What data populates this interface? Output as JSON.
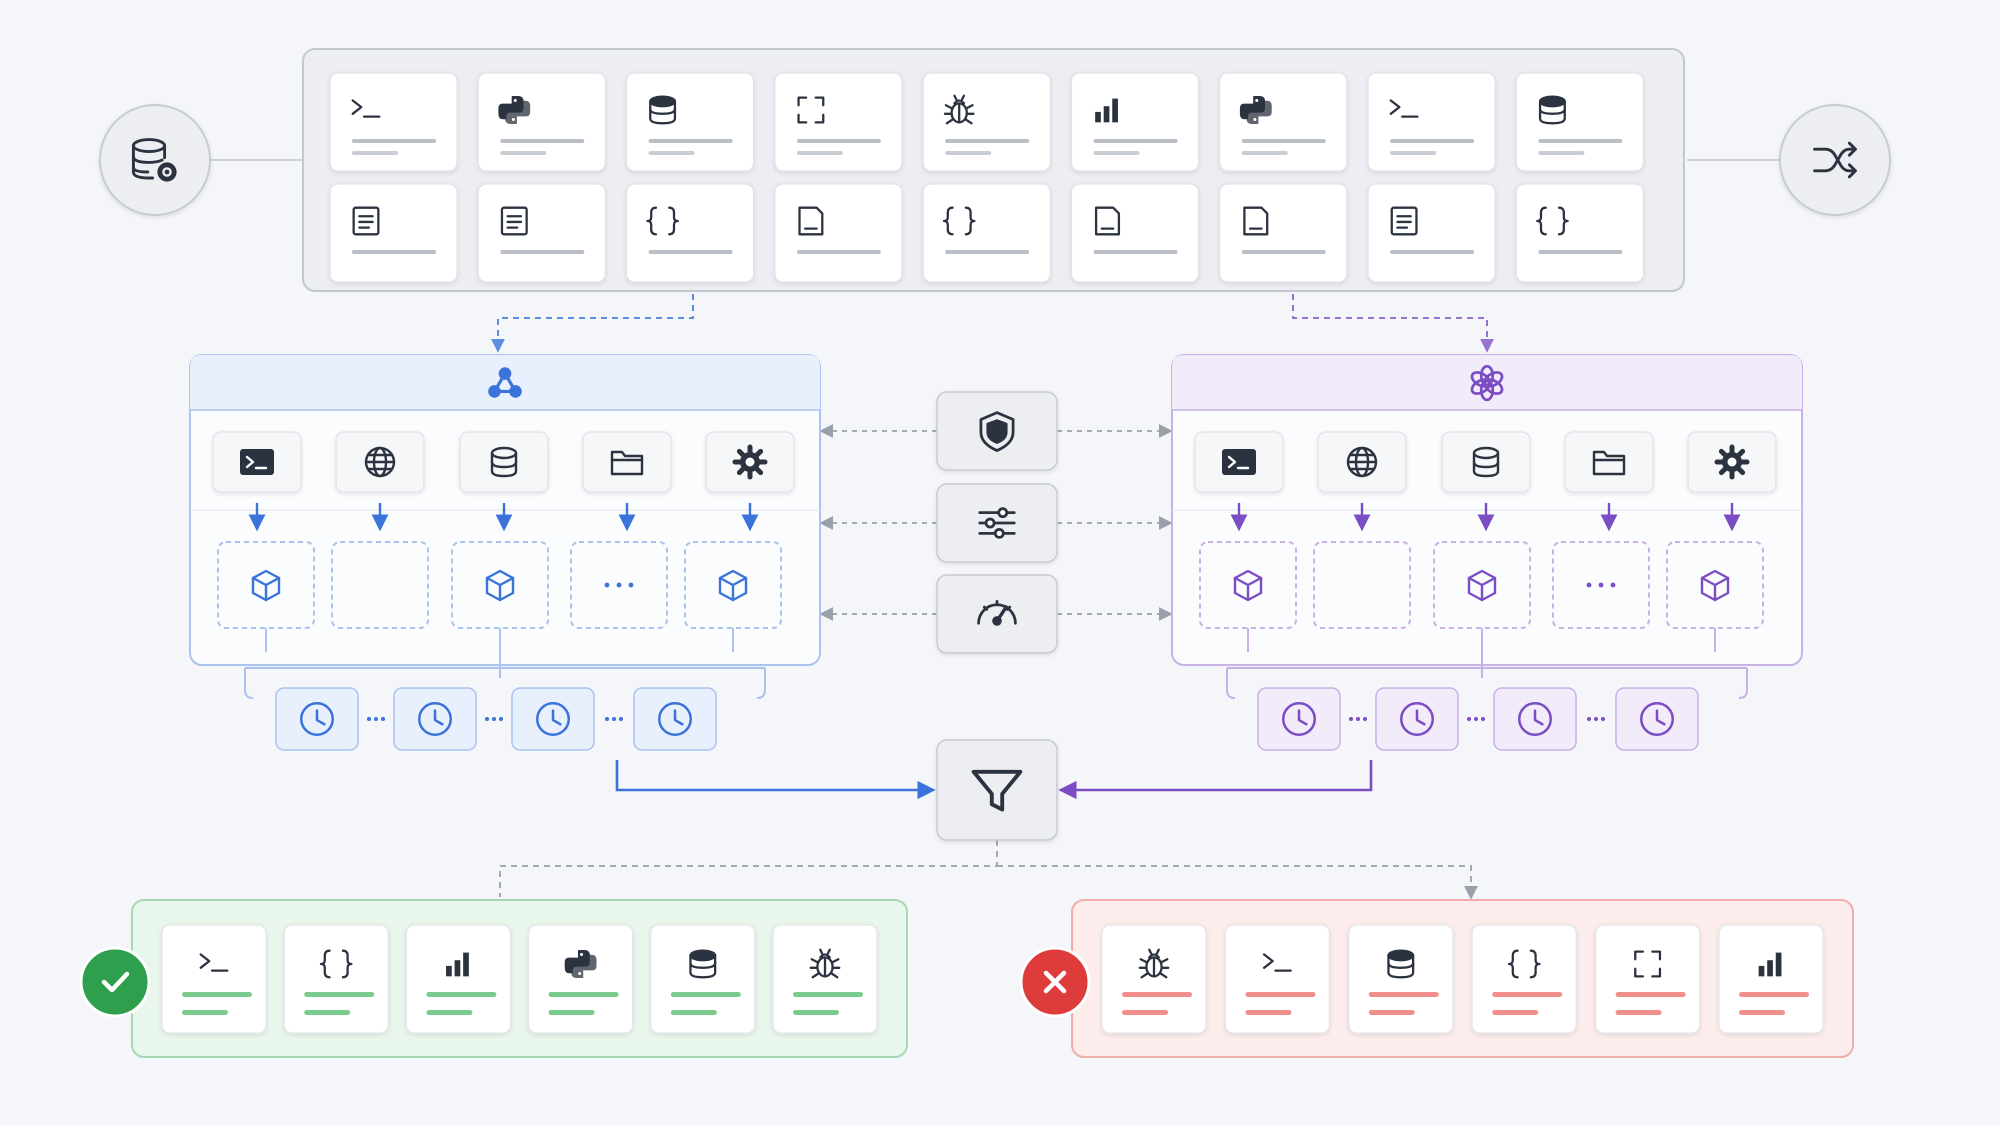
{
  "colors": {
    "background": "#f5f6fa",
    "neutral_panel": "#eceef3",
    "neutral_border": "#c3c7cf",
    "icon_dark": "#2c3340",
    "blue": "#3a73d9",
    "blue_light": "#e9f0fd",
    "blue_border": "#a9c3ee",
    "purple": "#7b4dc4",
    "purple_light": "#f1ebfa",
    "purple_border": "#c8b1e6",
    "green": "#2ea04d",
    "green_light": "#e9f6ec",
    "green_border": "#a8d8b3",
    "green_line": "#7ccb8e",
    "red": "#de3b3b",
    "red_light": "#fcecec",
    "red_border": "#f0adab",
    "red_line": "#f08f8c"
  },
  "left_node": {
    "icon": "database-gear-icon"
  },
  "right_node": {
    "icon": "shuffle-icon"
  },
  "pool": {
    "row1": [
      "terminal-icon",
      "python-icon",
      "database-icon",
      "fullscreen-icon",
      "bug-icon",
      "bar-chart-icon",
      "python-icon",
      "terminal-icon",
      "database-icon"
    ],
    "row2": [
      "document-lines-icon",
      "document-lines-icon",
      "braces-icon",
      "document-corner-icon",
      "braces-icon",
      "document-corner-icon",
      "document-corner-icon",
      "document-lines-icon",
      "braces-icon"
    ]
  },
  "panels": [
    {
      "id": "blue",
      "header_icon": "triangle-nodes-icon",
      "tools": [
        "terminal-icon",
        "globe-icon",
        "database-icon",
        "folder-icon",
        "gear-icon"
      ],
      "slots": [
        "cube",
        "empty",
        "cube",
        "ellipsis",
        "cube"
      ],
      "timers": 4
    },
    {
      "id": "purple",
      "header_icon": "flower-knot-icon",
      "tools": [
        "terminal-icon",
        "globe-icon",
        "database-icon",
        "folder-icon",
        "gear-icon"
      ],
      "slots": [
        "cube",
        "empty",
        "cube",
        "ellipsis",
        "cube"
      ],
      "timers": 4
    }
  ],
  "controls": [
    "shield-icon",
    "sliders-icon",
    "gauge-icon"
  ],
  "filter": {
    "icon": "funnel-icon"
  },
  "accepted": {
    "status_icon": "check-icon",
    "items": [
      "terminal-icon",
      "braces-icon",
      "bar-chart-icon",
      "python-icon",
      "database-icon",
      "bug-icon"
    ]
  },
  "rejected": {
    "status_icon": "x-icon",
    "items": [
      "bug-icon",
      "terminal-icon",
      "database-icon",
      "braces-icon",
      "fullscreen-icon",
      "bar-chart-icon"
    ]
  }
}
